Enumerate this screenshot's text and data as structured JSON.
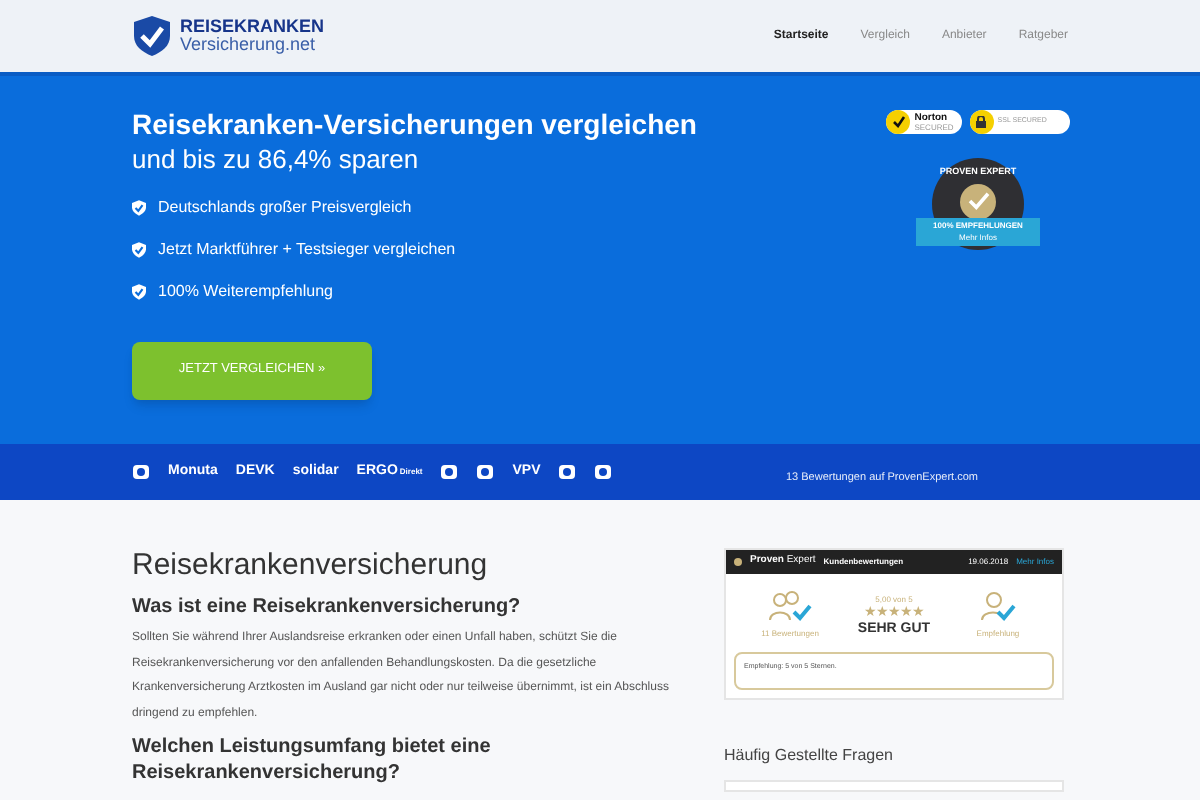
{
  "logo": {
    "line_1": "REISEKRANKEN",
    "line_2": "Versicherung.net"
  },
  "nav": [
    {
      "label": "Startseite",
      "selected": true
    },
    {
      "label": "Vergleich",
      "selected": false
    },
    {
      "label": "Anbieter",
      "selected": false
    },
    {
      "label": "Ratgeber",
      "selected": false
    }
  ],
  "hero": {
    "title": "Reisekranken-Versicherungen vergleichen",
    "subtitle": "und bis zu 86,4% sparen",
    "bullets": [
      "Deutschlands großer Preisvergleich",
      "Jetzt Marktführer + Testsieger vergleichen",
      "100% Weiterempfehlung"
    ],
    "button": "JETZT VERGLEICHEN »",
    "badges": [
      {
        "kind": "norton",
        "label": "Norton",
        "sub": "SECURED"
      },
      {
        "kind": "ssl",
        "label": "SSL SECURED"
      }
    ],
    "seal": {
      "arc": "PROVEN EXPERT",
      "ribbon": "100% EMPFEHLUNGEN",
      "sub": "Mehr Infos"
    }
  },
  "partners": [
    {
      "kind": "icon"
    },
    {
      "kind": "text",
      "label": "Monuta"
    },
    {
      "kind": "text",
      "label": "DEVK"
    },
    {
      "kind": "text",
      "label": "solidar"
    },
    {
      "kind": "text",
      "label": "ERGO",
      "sub": "Direkt"
    },
    {
      "kind": "icon"
    },
    {
      "kind": "icon"
    },
    {
      "kind": "text",
      "label": "VPV"
    },
    {
      "kind": "icon"
    },
    {
      "kind": "icon"
    }
  ],
  "reviews_link": "13 Bewertungen auf ProvenExpert.com",
  "article": {
    "title": "Reisekrankenversicherung",
    "sections": [
      {
        "heading": "Was ist eine Reisekrankenversicherung?",
        "text": "Sollten Sie während Ihrer Auslandsreise erkranken oder einen Unfall haben, schützt Sie die Reisekrankenversicherung vor den anfallenden Behandlungskosten. Da die gesetzliche Krankenversicherung Arztkosten im Ausland gar nicht oder nur teilweise übernimmt, ist ein Abschluss dringend zu empfehlen."
      },
      {
        "heading": "Welchen Leistungsumfang bietet eine Reisekrankenversicherung?"
      }
    ]
  },
  "widget": {
    "brand_1": "Proven",
    "brand_2": "Expert",
    "title": "Kundenbewertungen",
    "date": "19.06.2018",
    "more": "Mehr Infos",
    "count": "11 Bewertungen",
    "score": "5,00 von 5",
    "stars": 5,
    "rating": "SEHR GUT",
    "recommend": "Empfehlung",
    "quote": "Empfehlung: 5 von 5 Sternen."
  },
  "faq_title": "Häufig Gestellte Fragen"
}
